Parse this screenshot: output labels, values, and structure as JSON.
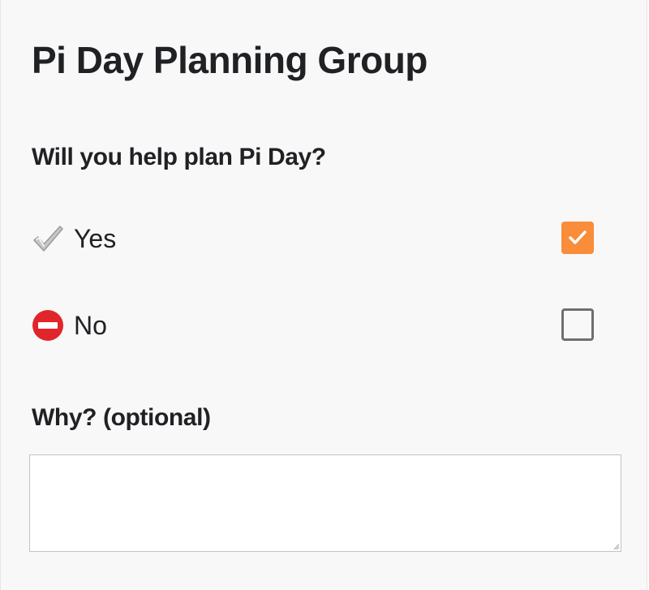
{
  "form": {
    "title": "Pi Day Planning Group",
    "question": "Will you help plan Pi Day?",
    "options": [
      {
        "label": "Yes",
        "icon": "check-mark-icon",
        "checked": true
      },
      {
        "label": "No",
        "icon": "no-entry-icon",
        "checked": false
      }
    ],
    "why_label": "Why? (optional)",
    "why_value": ""
  },
  "colors": {
    "checkbox_checked": "#f98d3a",
    "checkbox_border": "#6f6f6f",
    "no_entry_red": "#e0262b",
    "background": "#f8f8f8"
  }
}
